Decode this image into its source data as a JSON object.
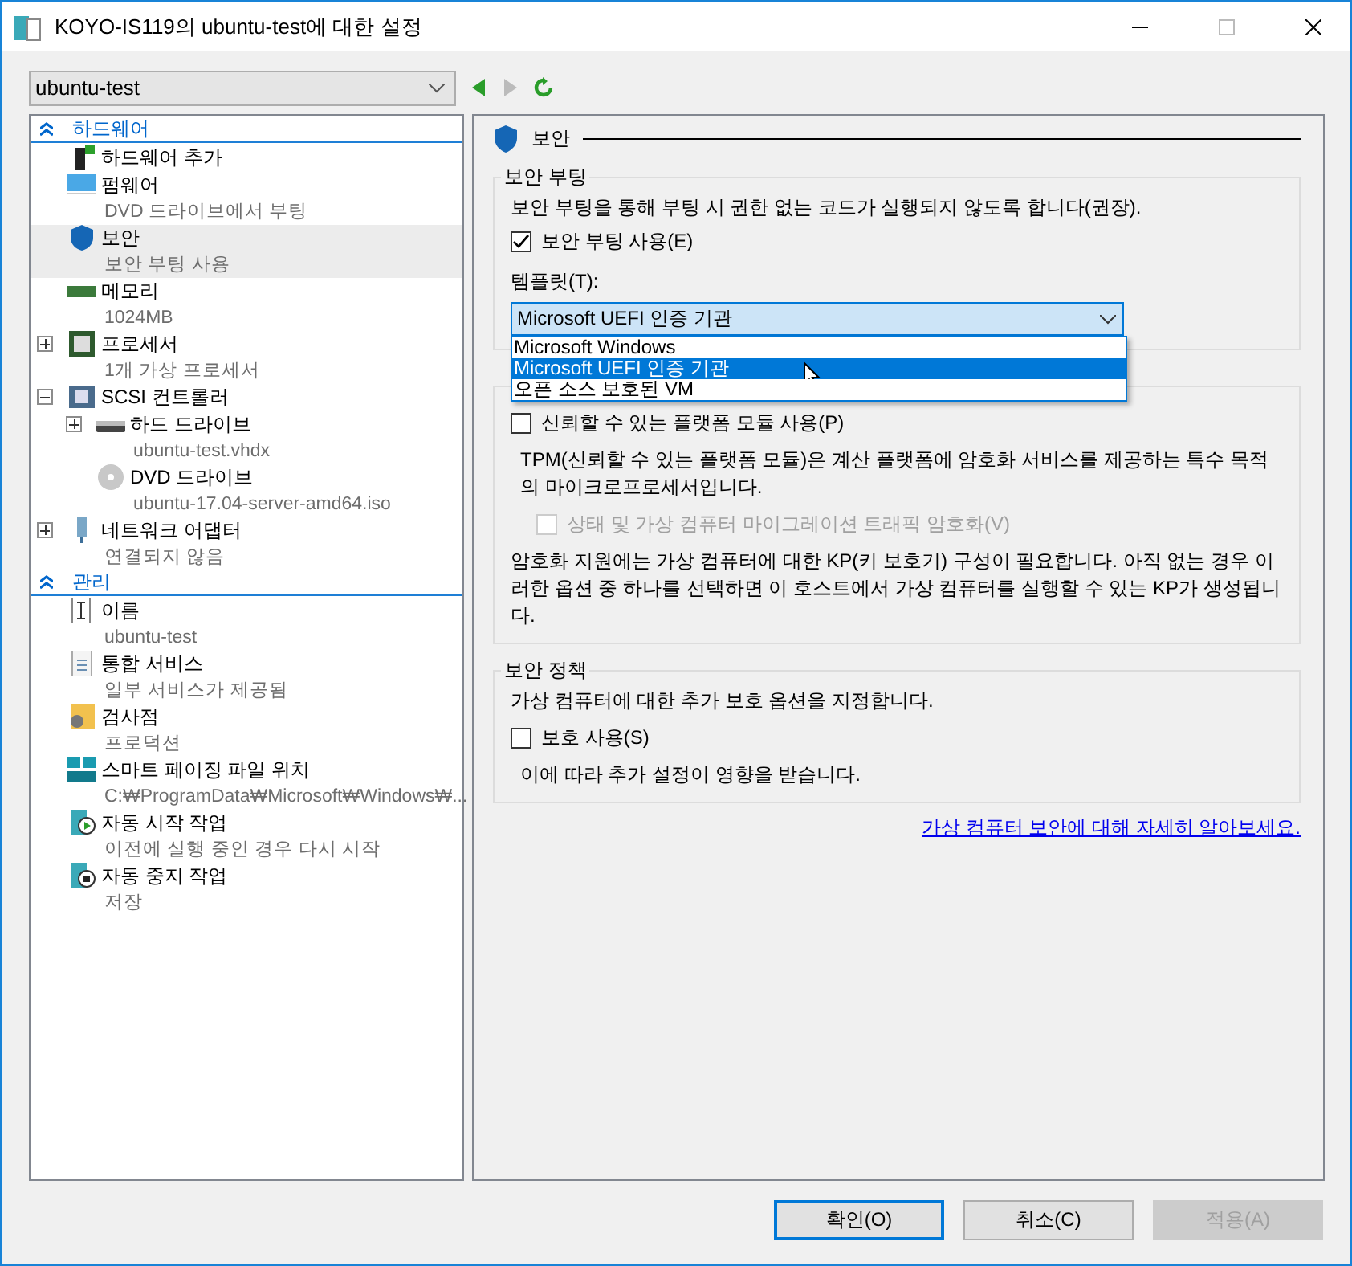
{
  "window": {
    "title": "KOYO-IS119의 ubuntu-test에 대한 설정"
  },
  "vm_selector": {
    "value": "ubuntu-test"
  },
  "sections": [
    {
      "title": "하드웨어",
      "expanded": true,
      "items": [
        {
          "label": "하드웨어 추가",
          "selected": false
        },
        {
          "label": "펌웨어",
          "sub": "DVD 드라이브에서 부팅",
          "selected": false
        },
        {
          "label": "보안",
          "sub": "보안 부팅 사용",
          "selected": true
        },
        {
          "label": "메모리",
          "sub": "1024MB",
          "selected": false
        },
        {
          "label": "프로세서",
          "sub": "1개 가상 프로세서",
          "selected": false,
          "expanded": false
        },
        {
          "label": "SCSI 컨트롤러",
          "selected": false,
          "expanded": true,
          "children": [
            {
              "label": "하드 드라이브",
              "sub": "ubuntu-test.vhdx",
              "selected": false,
              "expanded": false
            },
            {
              "label": "DVD 드라이브",
              "sub": "ubuntu-17.04-server-amd64.iso",
              "selected": false
            }
          ]
        },
        {
          "label": "네트워크 어댑터",
          "sub": "연결되지 않음",
          "selected": false,
          "expanded": false
        }
      ]
    },
    {
      "title": "관리",
      "expanded": true,
      "items": [
        {
          "label": "이름",
          "sub": "ubuntu-test",
          "selected": false
        },
        {
          "label": "통합 서비스",
          "sub": "일부 서비스가 제공됨",
          "selected": false
        },
        {
          "label": "검사점",
          "sub": "프로덕션",
          "selected": false
        },
        {
          "label": "스마트 페이징 파일 위치",
          "sub": "C:₩ProgramData₩Microsoft₩Windows₩...",
          "selected": false
        },
        {
          "label": "자동 시작 작업",
          "sub": "이전에 실행 중인 경우 다시 시작",
          "selected": false
        },
        {
          "label": "자동 중지 작업",
          "sub": "저장",
          "selected": false
        }
      ]
    }
  ],
  "panel": {
    "title": "보안",
    "secure_boot": {
      "legend": "보안 부팅",
      "description": "보안 부팅을 통해 부팅 시 권한 없는 코드가 실행되지 않도록 합니다(권장).",
      "checkbox": {
        "label": "보안 부팅 사용(E)",
        "checked": true
      },
      "template_label": "템플릿(T):",
      "template_value": "Microsoft UEFI 인증 기관",
      "options": [
        {
          "label": "Microsoft Windows",
          "selected": false
        },
        {
          "label": "Microsoft UEFI 인증 기관",
          "selected": true
        },
        {
          "label": "오픈 소스 보호된 VM",
          "selected": false
        }
      ]
    },
    "encryption": {
      "tpm": {
        "label": "신뢰할 수 있는 플랫폼 모듈 사용(P)",
        "checked": false
      },
      "tpm_description": "TPM(신뢰할 수 있는 플랫폼 모듈)은 계산 플랫폼에 암호화 서비스를 제공하는 특수 목적의 마이크로프로세서입니다.",
      "migration": {
        "label": "상태 및 가상 컴퓨터 마이그레이션 트래픽 암호화(V)",
        "checked": false,
        "disabled": true
      },
      "note": "암호화 지원에는 가상 컴퓨터에 대한 KP(키 보호기) 구성이 필요합니다. 아직 없는 경우 이러한 옵션 중 하나를 선택하면 이 호스트에서 가상 컴퓨터를 실행할 수 있는 KP가 생성됩니다."
    },
    "policy": {
      "legend": "보안 정책",
      "description": "가상 컴퓨터에 대한 추가 보호 옵션을 지정합니다.",
      "checkbox": {
        "label": "보호 사용(S)",
        "checked": false
      },
      "note": "이에 따라 추가 설정이 영향을 받습니다."
    },
    "link": "가상 컴퓨터 보안에 대해 자세히 알아보세요."
  },
  "buttons": [
    {
      "label": "확인(O)",
      "kind": "default",
      "disabled": false
    },
    {
      "label": "취소(C)",
      "kind": "normal",
      "disabled": false
    },
    {
      "label": "적용(A)",
      "kind": "normal",
      "disabled": true
    }
  ]
}
